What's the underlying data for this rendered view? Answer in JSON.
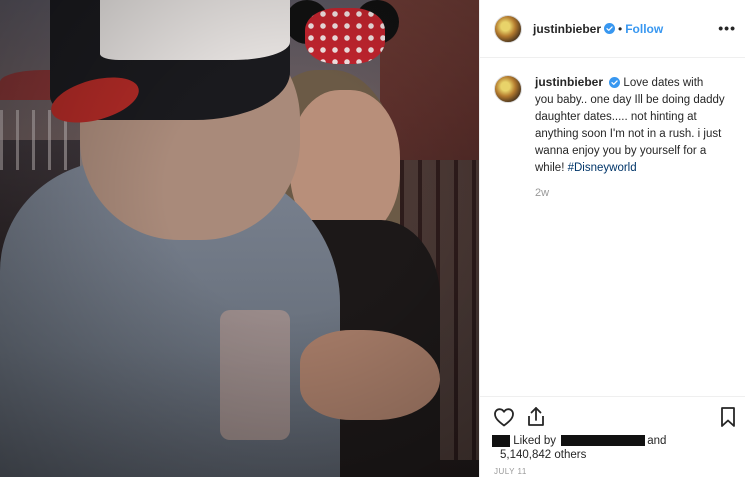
{
  "post": {
    "image_alt": "",
    "username": "justinbieber",
    "separator": "•",
    "follow_label": "Follow",
    "more_label": "•••"
  },
  "caption": {
    "username": "justinbieber",
    "text": "Love dates with you baby.. one day Ill be doing daddy daughter dates..... not hinting at anything soon I'm not in a rush. i just wanna enjoy you by yourself for a while! ",
    "hashtag": "#Disneyworld",
    "time_ago": "2w"
  },
  "likes": {
    "prefix": "Liked by",
    "suffix": "and",
    "count_text": "5,140,842 others",
    "date": "JULY 11"
  },
  "colors": {
    "link": "#3897f0",
    "verified": "#3897f0",
    "hashtag": "#003569",
    "muted": "#999999"
  },
  "icons": {
    "like": "heart-icon",
    "share": "share-icon",
    "save": "bookmark-icon",
    "verified": "verified-badge-icon",
    "more": "more-options-icon"
  }
}
